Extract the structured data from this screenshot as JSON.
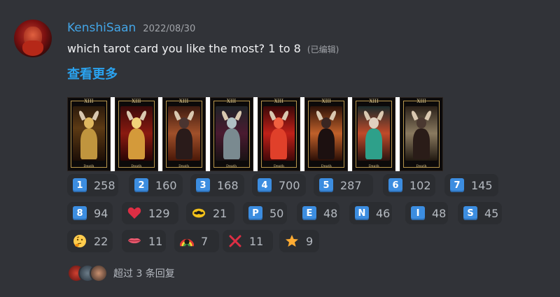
{
  "message": {
    "username": "KenshiSaan",
    "timestamp": "2022/08/30",
    "text": "which tarot card you like the most? 1 to 8",
    "edited": "(已编辑)",
    "see_more": "查看更多"
  },
  "cards": [
    {
      "numeral": "XIII",
      "caption": "Death"
    },
    {
      "numeral": "XIII",
      "caption": "Death"
    },
    {
      "numeral": "XIII",
      "caption": "Death"
    },
    {
      "numeral": "XIII",
      "caption": "Death"
    },
    {
      "numeral": "XIII",
      "caption": "Death"
    },
    {
      "numeral": "XIII",
      "caption": "Death"
    },
    {
      "numeral": "XIII",
      "caption": "Death"
    },
    {
      "numeral": "XIII",
      "caption": "Death"
    }
  ],
  "reactions": [
    {
      "emoji": "1",
      "icon": "keycap-1-icon",
      "count": "258"
    },
    {
      "emoji": "2",
      "icon": "keycap-2-icon",
      "count": "160"
    },
    {
      "emoji": "3",
      "icon": "keycap-3-icon",
      "count": "168"
    },
    {
      "emoji": "4",
      "icon": "keycap-4-icon",
      "count": "700"
    },
    {
      "emoji": "5",
      "icon": "keycap-5-icon",
      "count": "287"
    },
    {
      "emoji": "6",
      "icon": "keycap-6-icon",
      "count": "102"
    },
    {
      "emoji": "7",
      "icon": "keycap-7-icon",
      "count": "145"
    },
    {
      "emoji": "8",
      "icon": "keycap-8-icon",
      "count": "94"
    },
    {
      "emoji": "",
      "icon": "red-heart-icon",
      "count": "129"
    },
    {
      "emoji": "",
      "icon": "batman-emoji-icon",
      "count": "21"
    },
    {
      "emoji": "P",
      "icon": "regional-p-icon",
      "count": "50"
    },
    {
      "emoji": "E",
      "icon": "regional-e-icon",
      "count": "48"
    },
    {
      "emoji": "N",
      "icon": "regional-n-icon",
      "count": "46"
    },
    {
      "emoji": "I",
      "icon": "regional-i-icon",
      "count": "48"
    },
    {
      "emoji": "S",
      "icon": "regional-s-icon",
      "count": "45"
    },
    {
      "emoji": "",
      "icon": "thinking-face-icon",
      "count": "22"
    },
    {
      "emoji": "",
      "icon": "lips-icon",
      "count": "11"
    },
    {
      "emoji": "",
      "icon": "pride-rainbow-emoji-icon",
      "count": "7"
    },
    {
      "emoji": "",
      "icon": "red-cross-mark-icon",
      "count": "11"
    },
    {
      "emoji": "",
      "icon": "star-icon",
      "count": "9"
    }
  ],
  "thread": {
    "replies": "超过 3 条回复"
  },
  "colors": {
    "background": "#313338",
    "username": "#43a5e6",
    "link": "#2aa3f0",
    "reaction_bg": "#2b2d31",
    "keycap": "#3c8de0"
  }
}
